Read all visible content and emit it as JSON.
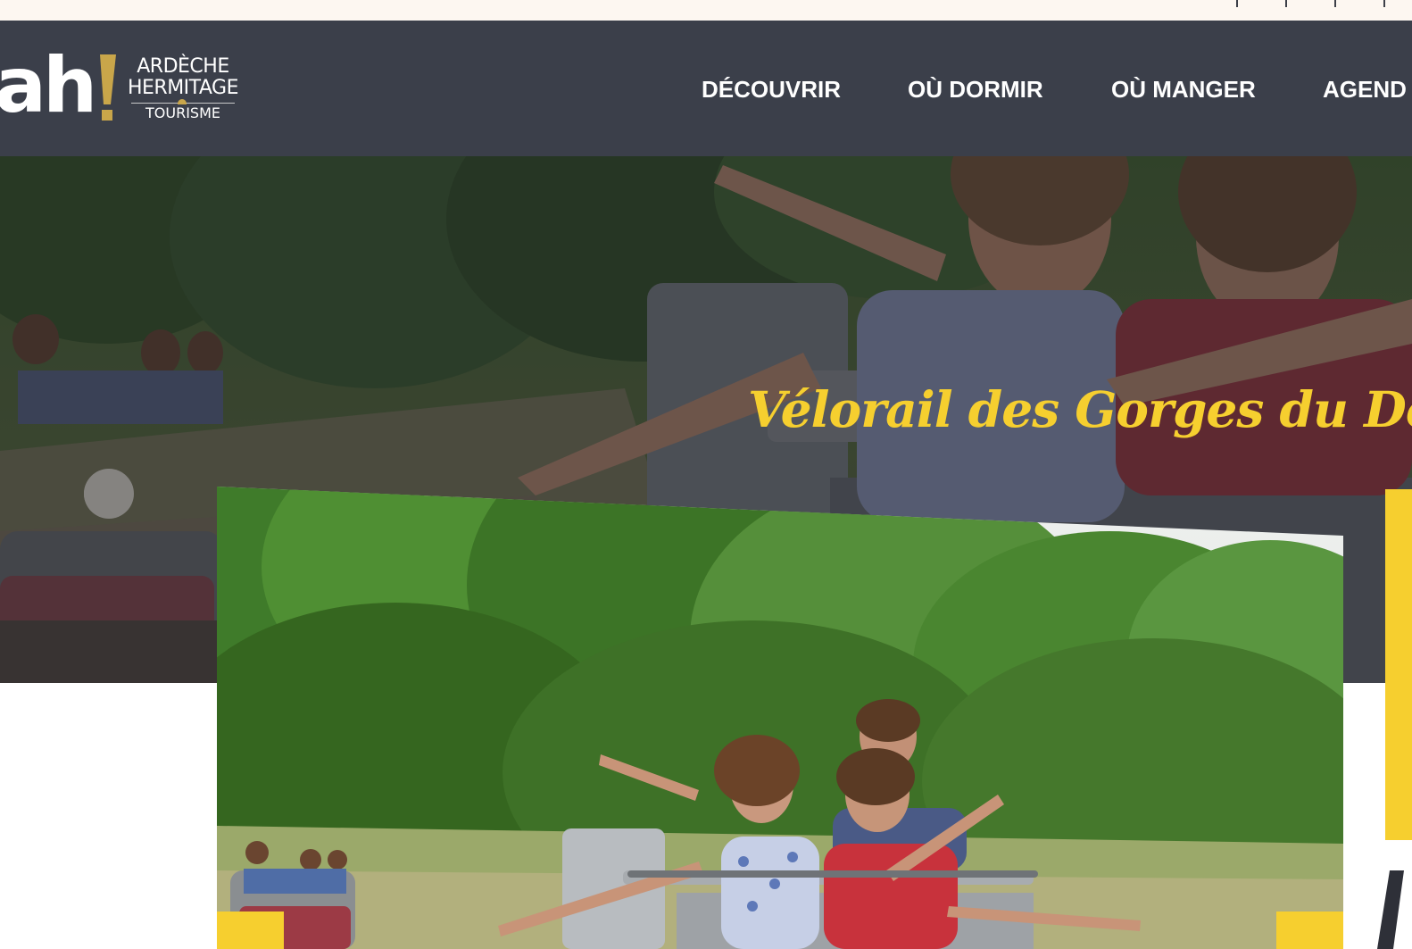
{
  "logo": {
    "mark": "ah",
    "line1": "ARDÈCHE",
    "line2": "HERMITAGE",
    "line3": "TOURISME"
  },
  "nav": {
    "items": [
      {
        "label": "DÉCOUVRIR"
      },
      {
        "label": "OÙ DORMIR"
      },
      {
        "label": "OÙ MANGER"
      },
      {
        "label": "AGEND"
      }
    ]
  },
  "hero": {
    "title": "Vélorail des Gorges du Doux"
  },
  "colors": {
    "navbar": "#3b3f4a",
    "accent_yellow": "#f6cf2f",
    "logo_gold": "#c9a64a",
    "top_strip": "#fdf7f1"
  }
}
